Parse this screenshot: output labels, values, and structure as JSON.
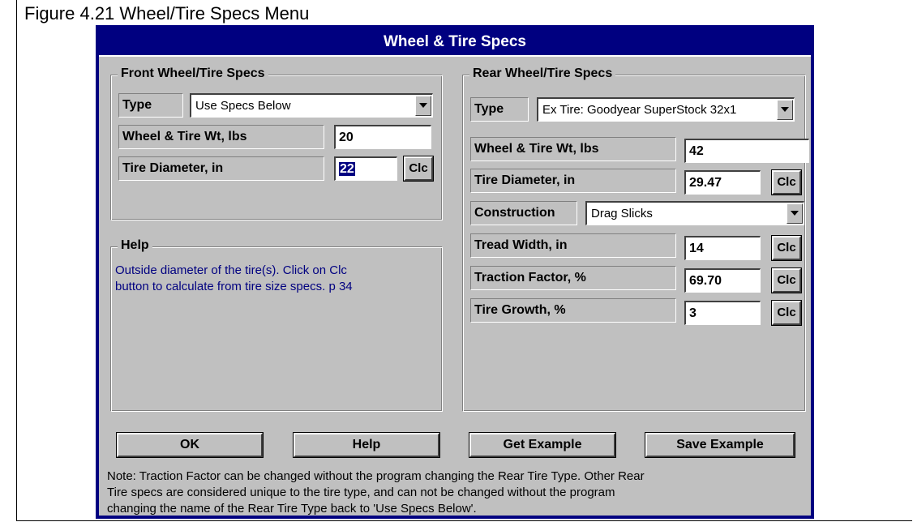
{
  "figure_caption": "Figure 4.21  Wheel/Tire Specs Menu",
  "window": {
    "title": "Wheel & Tire Specs"
  },
  "front": {
    "group_title": "Front Wheel/Tire Specs",
    "type_label": "Type",
    "type_value": "Use Specs Below",
    "weight_label": "Wheel & Tire Wt, lbs",
    "weight_value": "20",
    "diameter_label": "Tire Diameter, in",
    "diameter_value": "22",
    "clc_label": "Clc"
  },
  "help": {
    "group_title": "Help",
    "text_line1": "Outside diameter of the tire(s).  Click on Clc",
    "text_line2": "button to calculate from tire size specs.  p 34"
  },
  "rear": {
    "group_title": "Rear Wheel/Tire Specs",
    "type_label": "Type",
    "type_value": "Ex Tire: Goodyear SuperStock 32x1",
    "weight_label": "Wheel & Tire Wt, lbs",
    "weight_value": "42",
    "diameter_label": "Tire Diameter, in",
    "diameter_value": "29.47",
    "construction_label": "Construction",
    "construction_value": "Drag Slicks",
    "tread_label": "Tread Width, in",
    "tread_value": "14",
    "traction_label": "Traction Factor, %",
    "traction_value": "69.70",
    "growth_label": "Tire Growth, %",
    "growth_value": "3",
    "clc_label": "Clc"
  },
  "buttons": {
    "ok": "OK",
    "help": "Help",
    "get_example": "Get Example",
    "save_example": "Save Example"
  },
  "note": {
    "line1": "Note:  Traction Factor can be changed without the program changing the Rear Tire Type.  Other Rear",
    "line2": "Tire specs are considered unique to the tire type, and can not be changed without the program",
    "line3": "changing the name of the Rear Tire Type back to 'Use Specs Below'."
  }
}
